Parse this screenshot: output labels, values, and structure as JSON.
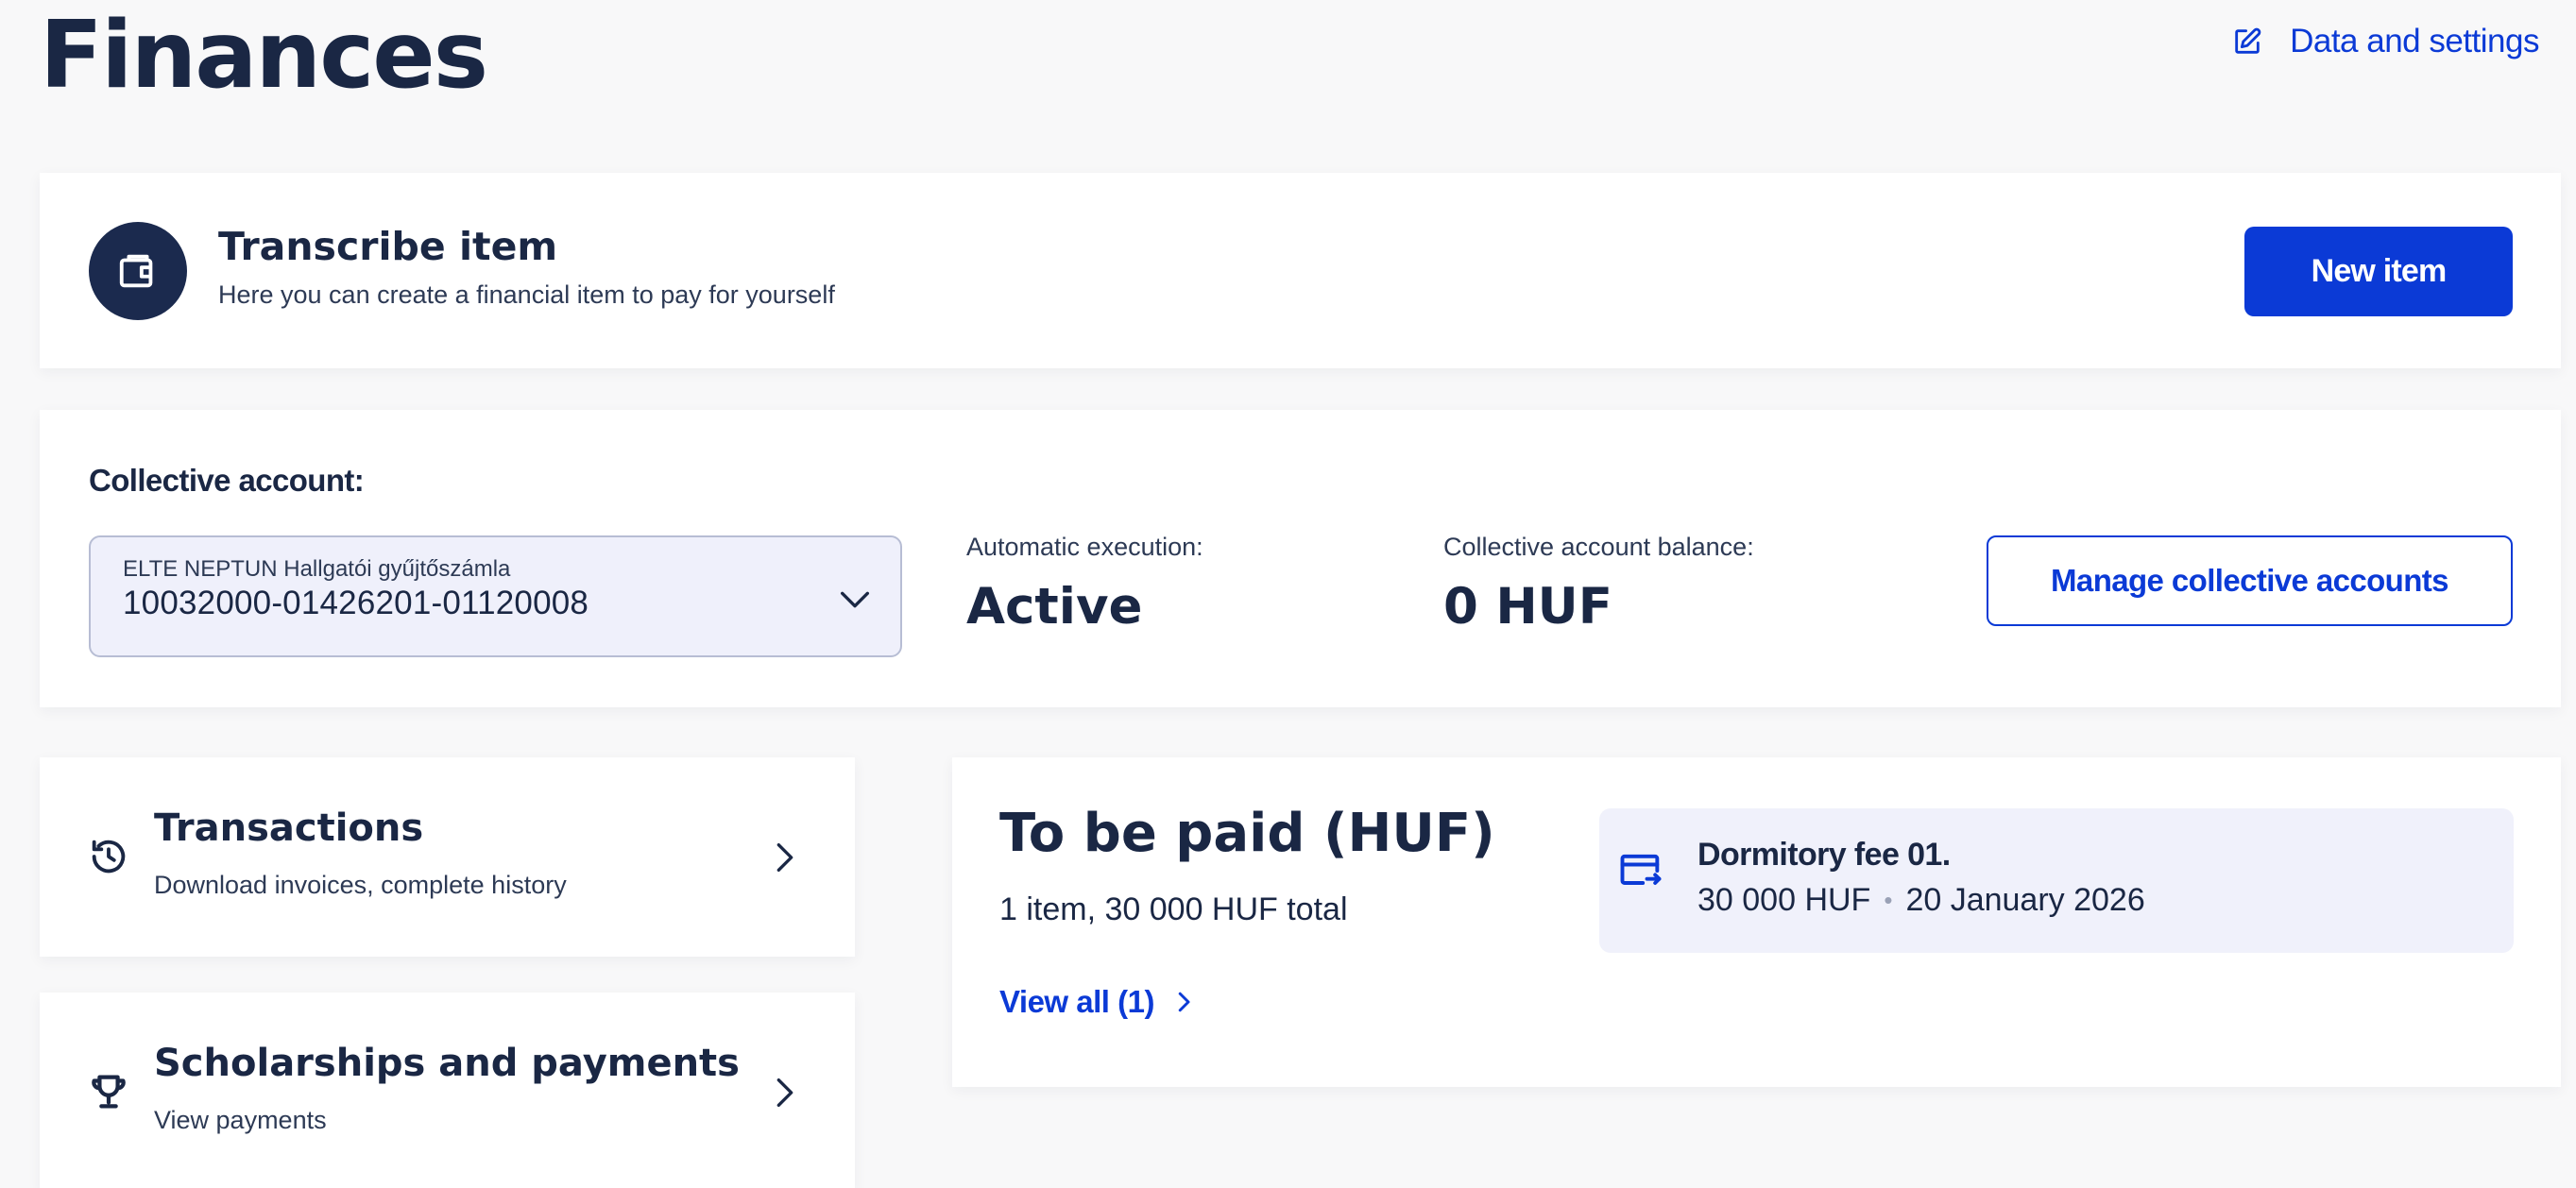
{
  "page": {
    "title": "Finances"
  },
  "header": {
    "settings_label": "Data and settings",
    "settings_icon": "edit-icon"
  },
  "transcribe": {
    "icon": "wallet-icon",
    "title": "Transcribe item",
    "subtitle": "Here you can create a financial item to pay for yourself",
    "button_label": "New item"
  },
  "collective": {
    "label": "Collective account:",
    "select": {
      "label": "ELTE NEPTUN Hallgatói gyűjtőszámla",
      "value": "10032000-01426201-01120008"
    },
    "automatic_execution_label": "Automatic execution:",
    "automatic_execution_value": "Active",
    "balance_label": "Collective account balance:",
    "balance_value": "0 HUF",
    "manage_button_label": "Manage collective accounts"
  },
  "nav": [
    {
      "icon": "history-icon",
      "title": "Transactions",
      "subtitle": "Download invoices, complete history"
    },
    {
      "icon": "trophy-icon",
      "title": "Scholarships and payments",
      "subtitle": "View payments"
    }
  ],
  "to_be_paid": {
    "title": "To be paid (HUF)",
    "summary": "1 item, 30 000 HUF total",
    "view_all_label": "View all (1)",
    "items": [
      {
        "icon": "card-transfer-icon",
        "title": "Dormitory fee 01.",
        "amount": "30 000 HUF",
        "separator": "•",
        "date": "20 January 2026"
      }
    ]
  },
  "colors": {
    "primary": "#0b3ad6",
    "navy": "#1a2744",
    "icon_circle": "#1b2a4e",
    "item_bg": "#f0f1fb",
    "page_bg": "#f8f8f9"
  }
}
